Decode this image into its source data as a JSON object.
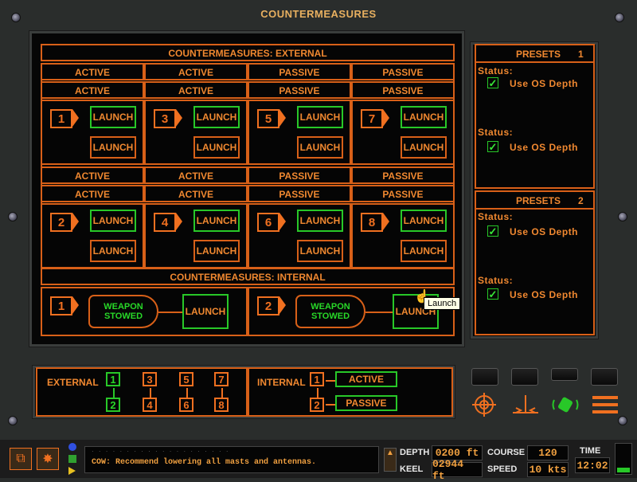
{
  "window": {
    "title": "COUNTERMEASURES"
  },
  "external": {
    "header": "COUNTERMEASURES: EXTERNAL",
    "top_mode_row1": [
      "ACTIVE",
      "ACTIVE",
      "PASSIVE",
      "PASSIVE"
    ],
    "top_mode_row2": [
      "ACTIVE",
      "ACTIVE",
      "PASSIVE",
      "PASSIVE"
    ],
    "top_numbers": [
      "1",
      "3",
      "5",
      "7"
    ],
    "bottom_mode_row1": [
      "ACTIVE",
      "ACTIVE",
      "PASSIVE",
      "PASSIVE"
    ],
    "bottom_mode_row2": [
      "ACTIVE",
      "ACTIVE",
      "PASSIVE",
      "PASSIVE"
    ],
    "bottom_numbers": [
      "2",
      "4",
      "6",
      "8"
    ],
    "launch_label": "LAUNCH"
  },
  "internal": {
    "header": "COUNTERMEASURES: INTERNAL",
    "tubes": [
      {
        "number": "1",
        "status_line1": "WEAPON",
        "status_line2": "STOWED",
        "launch_label": "LAUNCH"
      },
      {
        "number": "2",
        "status_line1": "WEAPON",
        "status_line2": "STOWED",
        "launch_label": "LAUNCH"
      }
    ],
    "tooltip": "Launch"
  },
  "presets": [
    {
      "title": "PRESETS",
      "number": "1",
      "status_label": "Status:",
      "option": "Use OS Depth",
      "checked": true
    },
    {
      "title": "PRESETS",
      "number": "2",
      "status_label": "Status:",
      "option": "Use OS Depth",
      "checked": true
    }
  ],
  "preset_check_glyph": "✓",
  "selector": {
    "external_label": "EXTERNAL",
    "external_numbers": [
      "1",
      "3",
      "5",
      "7",
      "2",
      "4",
      "6",
      "8"
    ],
    "internal_label": "INTERNAL",
    "internal_numbers": [
      "1",
      "2"
    ],
    "active_label": "ACTIVE",
    "passive_label": "PASSIVE"
  },
  "status_bar": {
    "message": "COW: Recommend lowering all masts and antennas.",
    "depth_label": "DEPTH",
    "depth_value": "0200 ft",
    "keel_label": "KEEL",
    "keel_value": "02944 ft",
    "course_label": "COURSE",
    "course_value": "120",
    "speed_label": "SPEED",
    "speed_value": "10 kts",
    "time_label": "TIME",
    "time_value": "12:02"
  },
  "colors": {
    "accent": "#f08830",
    "border": "#d86018",
    "armed": "#28c828",
    "panel": "#050505"
  }
}
